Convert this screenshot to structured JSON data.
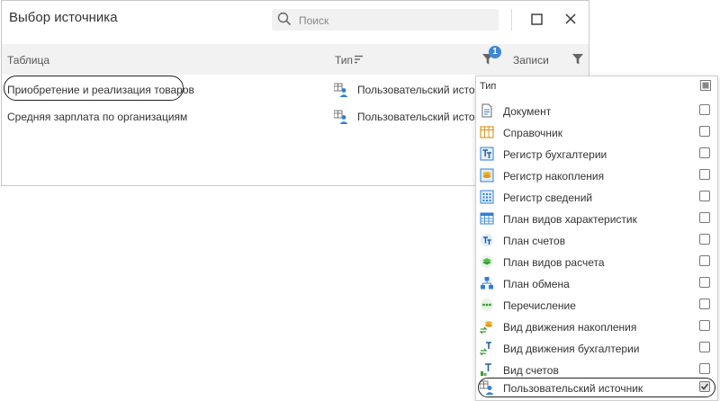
{
  "dialog": {
    "title": "Выбор источника",
    "search": {
      "placeholder": "Поиск",
      "value": ""
    }
  },
  "table": {
    "columns": {
      "table": "Таблица",
      "type": "Тип",
      "records": "Записи"
    },
    "type_filter_count": "1",
    "rows": [
      {
        "name": "Приобретение и реализация товаров",
        "type": "Пользовательский источн"
      },
      {
        "name": "Средняя зарплата по организациям",
        "type": "Пользовательский источн"
      }
    ]
  },
  "filter_panel": {
    "title": "Тип",
    "options": [
      {
        "label": "Документ",
        "icon": "document-icon",
        "checked": false
      },
      {
        "label": "Справочник",
        "icon": "catalog-icon",
        "checked": false
      },
      {
        "label": "Регистр бухгалтерии",
        "icon": "accounting-register-icon",
        "checked": false
      },
      {
        "label": "Регистр накопления",
        "icon": "accumulation-register-icon",
        "checked": false
      },
      {
        "label": "Регистр сведений",
        "icon": "information-register-icon",
        "checked": false
      },
      {
        "label": "План видов характеристик",
        "icon": "characteristic-types-icon",
        "checked": false
      },
      {
        "label": "План счетов",
        "icon": "chart-of-accounts-icon",
        "checked": false
      },
      {
        "label": "План видов расчета",
        "icon": "calculation-types-icon",
        "checked": false
      },
      {
        "label": "План обмена",
        "icon": "exchange-plan-icon",
        "checked": false
      },
      {
        "label": "Перечисление",
        "icon": "enumeration-icon",
        "checked": false
      },
      {
        "label": "Вид движения накопления",
        "icon": "accumulation-movement-icon",
        "checked": false
      },
      {
        "label": "Вид движения бухгалтерии",
        "icon": "accounting-movement-icon",
        "checked": false
      },
      {
        "label": "Вид счетов",
        "icon": "account-type-icon",
        "checked": false
      },
      {
        "label": "Пользовательский источник",
        "icon": "user-source-icon",
        "checked": true
      }
    ]
  },
  "colors": {
    "accent": "#3c87d8",
    "header_bg": "#f2f2f2"
  }
}
